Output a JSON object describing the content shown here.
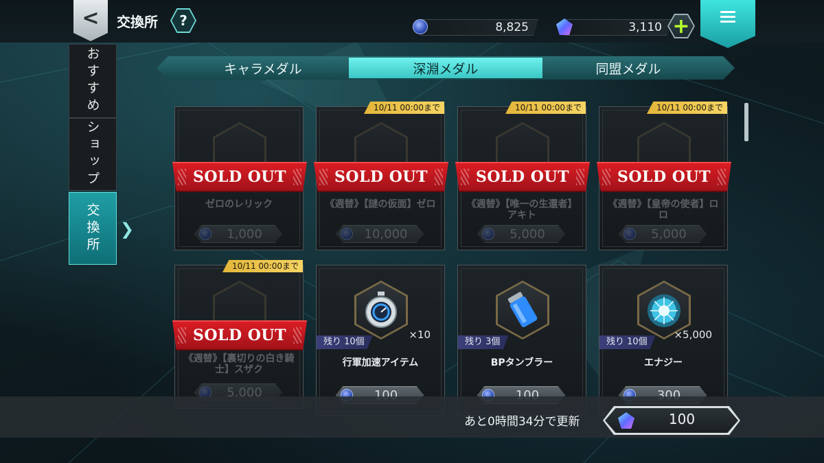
{
  "header": {
    "title": "交換所",
    "help_label": "?",
    "back_label": "<",
    "coin_value": "8,825",
    "gem_value": "3,110",
    "plus_label": "+"
  },
  "sidebar": {
    "items": [
      {
        "label": "おすすめ",
        "active": false
      },
      {
        "label": "ショップ",
        "active": false
      },
      {
        "label": "交換所",
        "active": true
      }
    ]
  },
  "tabs": [
    {
      "label": "キャラメダル",
      "active": false
    },
    {
      "label": "深淵メダル",
      "active": true
    },
    {
      "label": "同盟メダル",
      "active": false
    }
  ],
  "cards": [
    {
      "name": "ゼロのレリック",
      "price": "1,000",
      "deadline": "",
      "sold_out": true,
      "sold_out_label": "SOLD OUT"
    },
    {
      "name": "《週替》【謎の仮面】ゼロ",
      "price": "10,000",
      "deadline": "10/11 00:00まで",
      "sold_out": true,
      "sold_out_label": "SOLD OUT"
    },
    {
      "name": "《週替》【唯一の生還者】アキト",
      "price": "5,000",
      "deadline": "10/11 00:00まで",
      "sold_out": true,
      "sold_out_label": "SOLD OUT"
    },
    {
      "name": "《週替》【皇帝の使者】ロロ",
      "price": "5,000",
      "deadline": "10/11 00:00まで",
      "sold_out": true,
      "sold_out_label": "SOLD OUT"
    },
    {
      "name": "《週替》【裏切りの白き騎士】スザク",
      "price": "5,000",
      "deadline": "10/11 00:00まで",
      "sold_out": true,
      "sold_out_label": "SOLD OUT"
    },
    {
      "name": "行軍加速アイテム",
      "price": "100",
      "deadline": "",
      "sold_out": false,
      "remain": "残り 10個",
      "qty": "×10"
    },
    {
      "name": "BPタンブラー",
      "price": "100",
      "deadline": "",
      "sold_out": false,
      "remain": "残り 3個",
      "qty": ""
    },
    {
      "name": "エナジー",
      "price": "300",
      "deadline": "",
      "sold_out": false,
      "remain": "残り 10個",
      "qty": "×5,000"
    }
  ],
  "footer": {
    "refresh_text": "あと0時間34分で更新",
    "refresh_cost": "100"
  },
  "colors": {
    "accent": "#3bc6c4",
    "sold_out_red": "#d91d23",
    "deadline_gold": "#f0c64a"
  }
}
